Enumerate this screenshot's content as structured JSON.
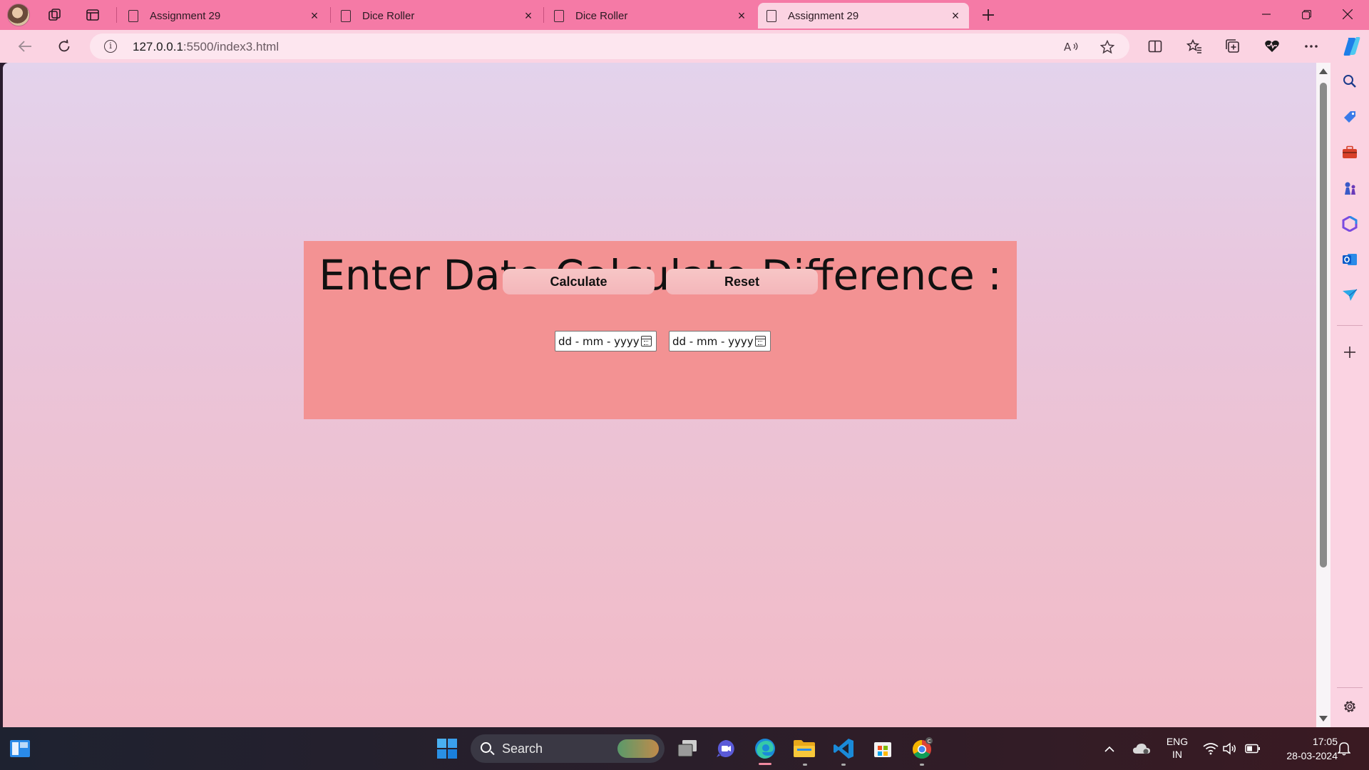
{
  "browser": {
    "tabs": [
      {
        "title": "Assignment 29",
        "active": false
      },
      {
        "title": "Dice Roller",
        "active": false
      },
      {
        "title": "Dice Roller",
        "active": false
      },
      {
        "title": "Assignment 29",
        "active": true
      }
    ],
    "address": {
      "host": "127.0.0.1",
      "path": ":5500/index3.html"
    }
  },
  "page": {
    "heading": "Enter Date Calculate Difference :",
    "date_inputs": [
      {
        "placeholder": "dd - mm - yyyy"
      },
      {
        "placeholder": "dd - mm - yyyy"
      }
    ],
    "buttons": {
      "calculate": "Calculate",
      "reset": "Reset"
    },
    "colors": {
      "card": "#f39293",
      "tabbar": "#f57aa6",
      "toolbar": "#fbd3e2"
    }
  },
  "taskbar": {
    "search_label": "Search",
    "language": {
      "line1": "ENG",
      "line2": "IN"
    },
    "time": "17:05",
    "date": "28-03-2024"
  }
}
